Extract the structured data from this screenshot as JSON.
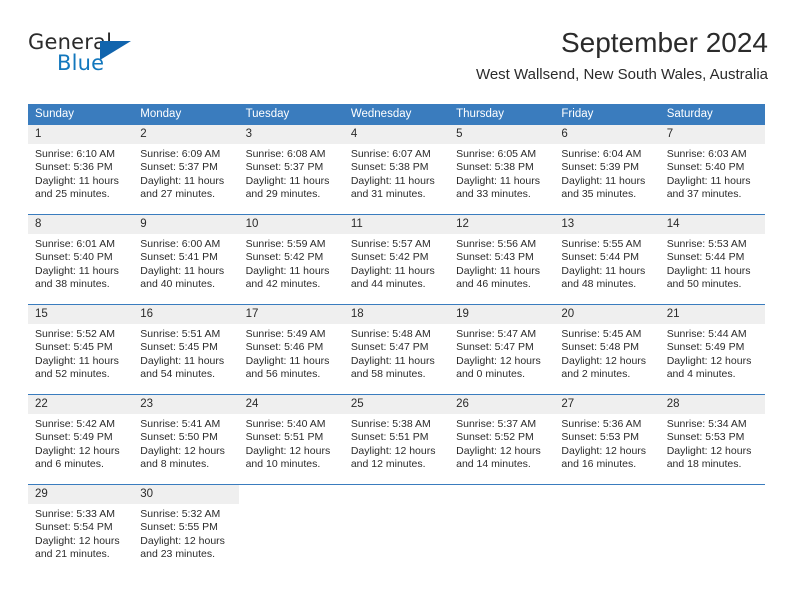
{
  "brand": {
    "word_one": "General",
    "word_two": "Blue",
    "triangle_icon": "blue-triangle-icon",
    "accent_color": "#1164ad",
    "text_color": "#1277bd"
  },
  "header": {
    "month_title": "September 2024",
    "location": "West Wallsend, New South Wales, Australia"
  },
  "calendar": {
    "header_bg": "#3a7cbe",
    "daynum_bg": "#efefef",
    "weekdays": [
      "Sunday",
      "Monday",
      "Tuesday",
      "Wednesday",
      "Thursday",
      "Friday",
      "Saturday"
    ],
    "weeks": [
      [
        {
          "day": "1",
          "sunrise": "Sunrise: 6:10 AM",
          "sunset": "Sunset: 5:36 PM",
          "daylight1": "Daylight: 11 hours",
          "daylight2": "and 25 minutes."
        },
        {
          "day": "2",
          "sunrise": "Sunrise: 6:09 AM",
          "sunset": "Sunset: 5:37 PM",
          "daylight1": "Daylight: 11 hours",
          "daylight2": "and 27 minutes."
        },
        {
          "day": "3",
          "sunrise": "Sunrise: 6:08 AM",
          "sunset": "Sunset: 5:37 PM",
          "daylight1": "Daylight: 11 hours",
          "daylight2": "and 29 minutes."
        },
        {
          "day": "4",
          "sunrise": "Sunrise: 6:07 AM",
          "sunset": "Sunset: 5:38 PM",
          "daylight1": "Daylight: 11 hours",
          "daylight2": "and 31 minutes."
        },
        {
          "day": "5",
          "sunrise": "Sunrise: 6:05 AM",
          "sunset": "Sunset: 5:38 PM",
          "daylight1": "Daylight: 11 hours",
          "daylight2": "and 33 minutes."
        },
        {
          "day": "6",
          "sunrise": "Sunrise: 6:04 AM",
          "sunset": "Sunset: 5:39 PM",
          "daylight1": "Daylight: 11 hours",
          "daylight2": "and 35 minutes."
        },
        {
          "day": "7",
          "sunrise": "Sunrise: 6:03 AM",
          "sunset": "Sunset: 5:40 PM",
          "daylight1": "Daylight: 11 hours",
          "daylight2": "and 37 minutes."
        }
      ],
      [
        {
          "day": "8",
          "sunrise": "Sunrise: 6:01 AM",
          "sunset": "Sunset: 5:40 PM",
          "daylight1": "Daylight: 11 hours",
          "daylight2": "and 38 minutes."
        },
        {
          "day": "9",
          "sunrise": "Sunrise: 6:00 AM",
          "sunset": "Sunset: 5:41 PM",
          "daylight1": "Daylight: 11 hours",
          "daylight2": "and 40 minutes."
        },
        {
          "day": "10",
          "sunrise": "Sunrise: 5:59 AM",
          "sunset": "Sunset: 5:42 PM",
          "daylight1": "Daylight: 11 hours",
          "daylight2": "and 42 minutes."
        },
        {
          "day": "11",
          "sunrise": "Sunrise: 5:57 AM",
          "sunset": "Sunset: 5:42 PM",
          "daylight1": "Daylight: 11 hours",
          "daylight2": "and 44 minutes."
        },
        {
          "day": "12",
          "sunrise": "Sunrise: 5:56 AM",
          "sunset": "Sunset: 5:43 PM",
          "daylight1": "Daylight: 11 hours",
          "daylight2": "and 46 minutes."
        },
        {
          "day": "13",
          "sunrise": "Sunrise: 5:55 AM",
          "sunset": "Sunset: 5:44 PM",
          "daylight1": "Daylight: 11 hours",
          "daylight2": "and 48 minutes."
        },
        {
          "day": "14",
          "sunrise": "Sunrise: 5:53 AM",
          "sunset": "Sunset: 5:44 PM",
          "daylight1": "Daylight: 11 hours",
          "daylight2": "and 50 minutes."
        }
      ],
      [
        {
          "day": "15",
          "sunrise": "Sunrise: 5:52 AM",
          "sunset": "Sunset: 5:45 PM",
          "daylight1": "Daylight: 11 hours",
          "daylight2": "and 52 minutes."
        },
        {
          "day": "16",
          "sunrise": "Sunrise: 5:51 AM",
          "sunset": "Sunset: 5:45 PM",
          "daylight1": "Daylight: 11 hours",
          "daylight2": "and 54 minutes."
        },
        {
          "day": "17",
          "sunrise": "Sunrise: 5:49 AM",
          "sunset": "Sunset: 5:46 PM",
          "daylight1": "Daylight: 11 hours",
          "daylight2": "and 56 minutes."
        },
        {
          "day": "18",
          "sunrise": "Sunrise: 5:48 AM",
          "sunset": "Sunset: 5:47 PM",
          "daylight1": "Daylight: 11 hours",
          "daylight2": "and 58 minutes."
        },
        {
          "day": "19",
          "sunrise": "Sunrise: 5:47 AM",
          "sunset": "Sunset: 5:47 PM",
          "daylight1": "Daylight: 12 hours",
          "daylight2": "and 0 minutes."
        },
        {
          "day": "20",
          "sunrise": "Sunrise: 5:45 AM",
          "sunset": "Sunset: 5:48 PM",
          "daylight1": "Daylight: 12 hours",
          "daylight2": "and 2 minutes."
        },
        {
          "day": "21",
          "sunrise": "Sunrise: 5:44 AM",
          "sunset": "Sunset: 5:49 PM",
          "daylight1": "Daylight: 12 hours",
          "daylight2": "and 4 minutes."
        }
      ],
      [
        {
          "day": "22",
          "sunrise": "Sunrise: 5:42 AM",
          "sunset": "Sunset: 5:49 PM",
          "daylight1": "Daylight: 12 hours",
          "daylight2": "and 6 minutes."
        },
        {
          "day": "23",
          "sunrise": "Sunrise: 5:41 AM",
          "sunset": "Sunset: 5:50 PM",
          "daylight1": "Daylight: 12 hours",
          "daylight2": "and 8 minutes."
        },
        {
          "day": "24",
          "sunrise": "Sunrise: 5:40 AM",
          "sunset": "Sunset: 5:51 PM",
          "daylight1": "Daylight: 12 hours",
          "daylight2": "and 10 minutes."
        },
        {
          "day": "25",
          "sunrise": "Sunrise: 5:38 AM",
          "sunset": "Sunset: 5:51 PM",
          "daylight1": "Daylight: 12 hours",
          "daylight2": "and 12 minutes."
        },
        {
          "day": "26",
          "sunrise": "Sunrise: 5:37 AM",
          "sunset": "Sunset: 5:52 PM",
          "daylight1": "Daylight: 12 hours",
          "daylight2": "and 14 minutes."
        },
        {
          "day": "27",
          "sunrise": "Sunrise: 5:36 AM",
          "sunset": "Sunset: 5:53 PM",
          "daylight1": "Daylight: 12 hours",
          "daylight2": "and 16 minutes."
        },
        {
          "day": "28",
          "sunrise": "Sunrise: 5:34 AM",
          "sunset": "Sunset: 5:53 PM",
          "daylight1": "Daylight: 12 hours",
          "daylight2": "and 18 minutes."
        }
      ],
      [
        {
          "day": "29",
          "sunrise": "Sunrise: 5:33 AM",
          "sunset": "Sunset: 5:54 PM",
          "daylight1": "Daylight: 12 hours",
          "daylight2": "and 21 minutes."
        },
        {
          "day": "30",
          "sunrise": "Sunrise: 5:32 AM",
          "sunset": "Sunset: 5:55 PM",
          "daylight1": "Daylight: 12 hours",
          "daylight2": "and 23 minutes."
        },
        {
          "day": "",
          "sunrise": "",
          "sunset": "",
          "daylight1": "",
          "daylight2": ""
        },
        {
          "day": "",
          "sunrise": "",
          "sunset": "",
          "daylight1": "",
          "daylight2": ""
        },
        {
          "day": "",
          "sunrise": "",
          "sunset": "",
          "daylight1": "",
          "daylight2": ""
        },
        {
          "day": "",
          "sunrise": "",
          "sunset": "",
          "daylight1": "",
          "daylight2": ""
        },
        {
          "day": "",
          "sunrise": "",
          "sunset": "",
          "daylight1": "",
          "daylight2": ""
        }
      ]
    ]
  }
}
